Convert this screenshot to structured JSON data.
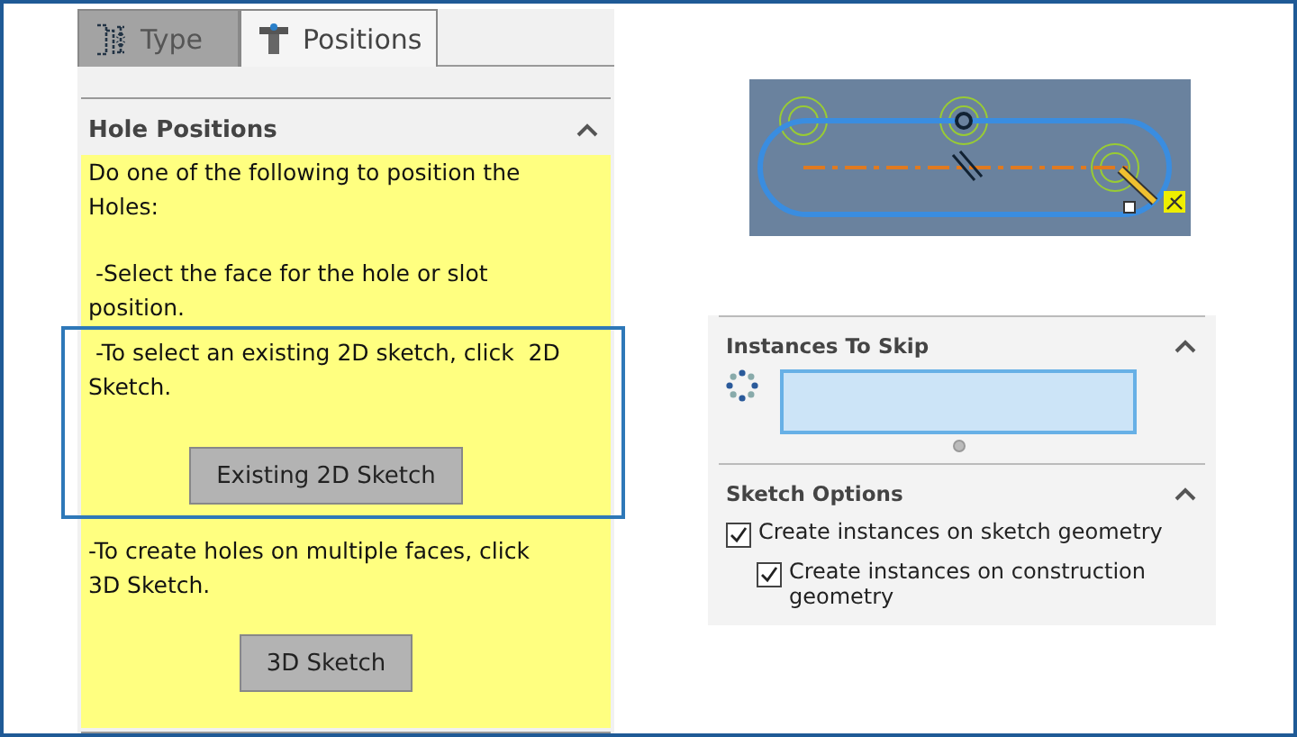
{
  "tabs": [
    {
      "label": "Type",
      "selected": false
    },
    {
      "label": "Positions",
      "selected": true
    }
  ],
  "hole_positions": {
    "title": "Hole Positions",
    "expanded": true,
    "blocks": [
      {
        "kind": "text",
        "text": "Do one of the following to position the Holes:"
      },
      {
        "kind": "text",
        "text": " -Select the face for the hole or slot position."
      },
      {
        "kind": "text",
        "text": " -To select an existing 2D sketch, click  2D Sketch."
      },
      {
        "kind": "button",
        "text": "Existing 2D Sketch"
      },
      {
        "kind": "text",
        "text": "-To create holes on multiple faces, click 3D Sketch."
      },
      {
        "kind": "button",
        "text": "3D Sketch"
      }
    ]
  },
  "instances_to_skip": {
    "title": "Instances To Skip",
    "expanded": true
  },
  "sketch_options": {
    "title": "Sketch Options",
    "expanded": true,
    "options": [
      {
        "label": "Create instances on sketch geometry",
        "checked": true,
        "children": [
          {
            "label": "Create instances on construction geometry",
            "checked": true
          }
        ]
      }
    ]
  }
}
